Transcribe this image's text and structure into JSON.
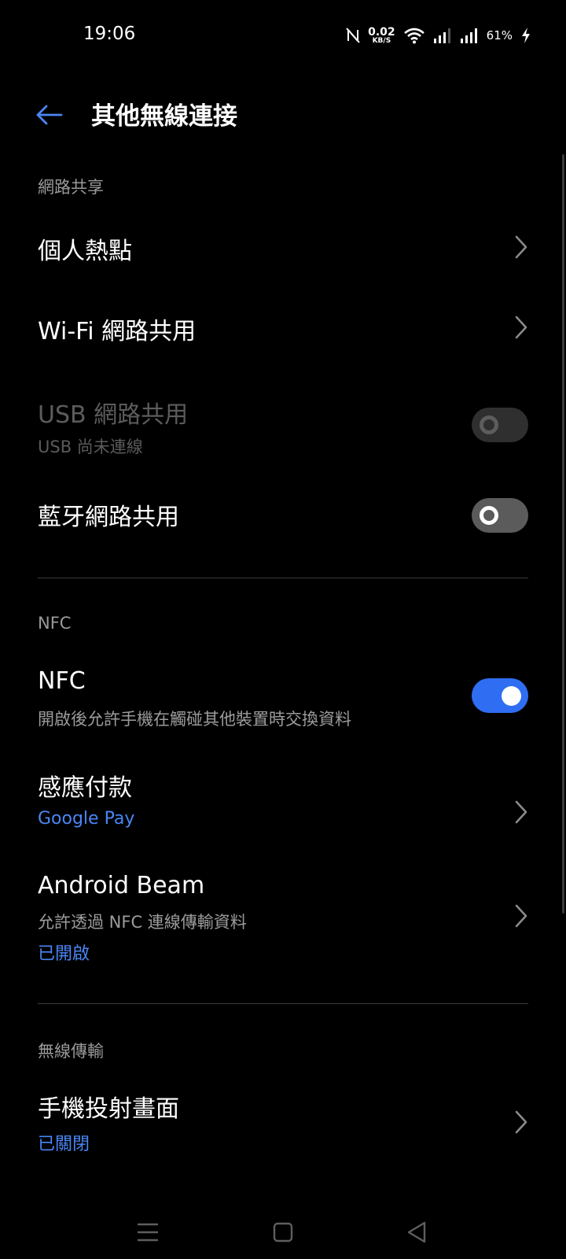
{
  "status_bar": {
    "time": "19:06",
    "net_speed_value": "0.02",
    "net_speed_unit": "KB/S",
    "battery": "61%"
  },
  "header": {
    "title": "其他無線連接"
  },
  "sections": {
    "tethering": "網路共享",
    "nfc": "NFC",
    "wireless": "無線傳輸"
  },
  "items": {
    "hotspot": {
      "title": "個人熱點"
    },
    "wifi_share": {
      "title": "Wi-Fi 網路共用"
    },
    "usb_share": {
      "title": "USB 網路共用",
      "subtitle": "USB 尚未連線",
      "enabled": false,
      "on": false
    },
    "bt_share": {
      "title": "藍牙網路共用",
      "on": false
    },
    "nfc": {
      "title": "NFC",
      "subtitle": "開啟後允許手機在觸碰其他裝置時交換資料",
      "on": true
    },
    "tap_pay": {
      "title": "感應付款",
      "status": "Google Pay"
    },
    "android_beam": {
      "title": "Android Beam",
      "subtitle": "允許透過 NFC 連線傳輸資料",
      "status": "已開啟"
    },
    "screen_cast": {
      "title": "手機投射畫面",
      "status": "已關閉"
    }
  },
  "colors": {
    "accent": "#2f6ef2",
    "link": "#4a86f5",
    "background": "#000000"
  }
}
